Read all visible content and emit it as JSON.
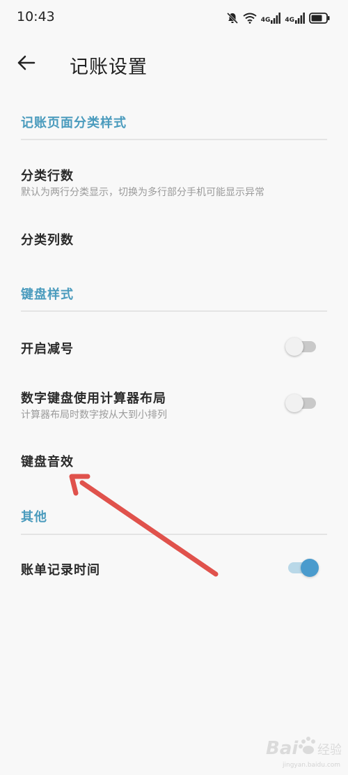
{
  "status_bar": {
    "time": "10:43",
    "net1": "4G",
    "net2": "4G",
    "icons": [
      "bell-mute-icon",
      "wifi-icon",
      "signal-icon",
      "signal-icon",
      "battery-icon"
    ]
  },
  "app_bar": {
    "title": "记账设置",
    "back_icon": "arrow-left-icon"
  },
  "sections": {
    "category": {
      "header": "记账页面分类样式",
      "items": [
        {
          "title": "分类行数",
          "subtitle": "默认为两行分类显示，切换为多行部分手机可能显示异常"
        },
        {
          "title": "分类列数"
        }
      ]
    },
    "keyboard": {
      "header": "键盘样式",
      "items": [
        {
          "title": "开启减号",
          "toggle_on": false
        },
        {
          "title": "数字键盘使用计算器布局",
          "subtitle": "计算器布局时数字按从大到小排列",
          "toggle_on": false
        },
        {
          "title": "键盘音效"
        }
      ]
    },
    "other": {
      "header": "其他",
      "items": [
        {
          "title": "账单记录时间",
          "toggle_on": true
        }
      ]
    }
  },
  "colors": {
    "accent": "#4a9bbd",
    "toggle_on": "#4a9bcd",
    "annotation_arrow": "#e0524c"
  }
}
